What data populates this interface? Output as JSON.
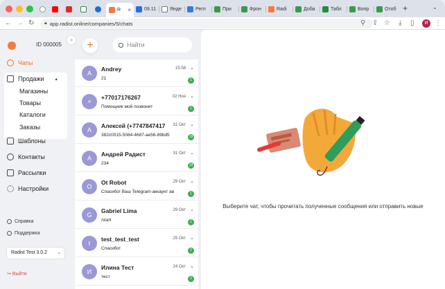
{
  "browser": {
    "tabs": [
      {
        "label": ""
      },
      {
        "label": ""
      },
      {
        "label": ""
      },
      {
        "label": ""
      },
      {
        "label": ""
      },
      {
        "label": "R"
      },
      {
        "label": "09.11"
      },
      {
        "label": "Янде"
      },
      {
        "label": "Регл"
      },
      {
        "label": "При"
      },
      {
        "label": "Фрон"
      },
      {
        "label": "Radi"
      },
      {
        "label": "Доба"
      },
      {
        "label": "Табл"
      },
      {
        "label": "Вопр"
      },
      {
        "label": "Отоб"
      }
    ],
    "new_tab": "+",
    "url": "app.radist.online/companies/5/chats",
    "profile_initial": "И"
  },
  "sidebar": {
    "company_id": "ID 000005",
    "items": [
      {
        "label": "Чаты"
      },
      {
        "label": "Продажи"
      },
      {
        "label": "Шаблоны"
      },
      {
        "label": "Контакты"
      },
      {
        "label": "Рассылки"
      },
      {
        "label": "Настройки"
      }
    ],
    "sales_sub": [
      {
        "label": "Магазины"
      },
      {
        "label": "Товары"
      },
      {
        "label": "Каталоги"
      },
      {
        "label": "Заказы"
      }
    ],
    "help": "Справка",
    "support": "Поддержка",
    "version": "Radist Test 3.0.2",
    "logout": "Выйти"
  },
  "chat_list": {
    "search_placeholder": "Найти",
    "chats": [
      {
        "initial": "A",
        "name": "Andrey",
        "message": "21",
        "date": "15:58",
        "badge": "1"
      },
      {
        "initial": "+",
        "name": "+77017176267",
        "message": "Помощник мой позвонит",
        "date": "02 Ноя",
        "badge": "1"
      },
      {
        "initial": "А",
        "name": "Алексей (+7747847417",
        "message": "382c0015-5084-4687-ae56-89bd5",
        "date": "31 Окт",
        "badge": "19"
      },
      {
        "initial": "А",
        "name": "Андрей Радист",
        "message": "234",
        "date": "31 Окт",
        "badge": "19"
      },
      {
        "initial": "O",
        "name": "Ot Robot",
        "message": "Спасибо! Ваш Telegram-аккаунт ав",
        "date": "29 Окт",
        "badge": "1"
      },
      {
        "initial": "G",
        "name": "Gabriel Lima",
        "message": "/start",
        "date": "29 Окт",
        "badge": "1"
      },
      {
        "initial": "t",
        "name": "test_test_test",
        "message": "Спасибо!",
        "date": "25 Окт",
        "badge": "2"
      },
      {
        "initial": "И",
        "name": "Илина Тест",
        "message": "тест",
        "date": "24 Окт",
        "badge": "2"
      }
    ]
  },
  "main": {
    "empty_text": "Выберите чат, чтобы прочитать полученные сообщения или отправить новые"
  },
  "colors": {
    "accent": "#f26a24",
    "badge": "#3dae4e",
    "avatar": "#9b98d6"
  }
}
